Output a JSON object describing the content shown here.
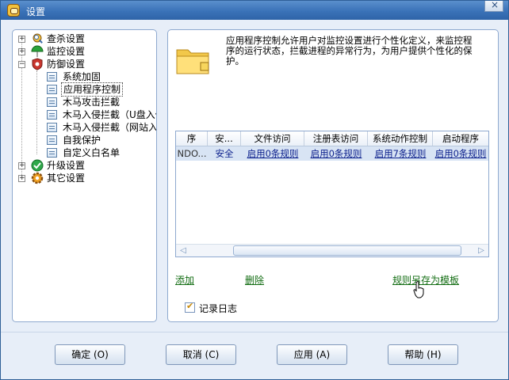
{
  "window": {
    "title": "设置",
    "close_glyph": "×"
  },
  "tree": {
    "items": [
      {
        "label": "查杀设置",
        "icon": "search-shield-icon",
        "expander": "+"
      },
      {
        "label": "监控设置",
        "icon": "umbrella-icon",
        "expander": "+"
      },
      {
        "label": "防御设置",
        "icon": "shield-icon",
        "expander": "−"
      },
      {
        "label": "系统加固",
        "icon": "page-icon"
      },
      {
        "label": "应用程序控制",
        "icon": "page-icon",
        "selected": true
      },
      {
        "label": "木马攻击拦截",
        "icon": "page-icon"
      },
      {
        "label": "木马入侵拦截（U盘入侵",
        "icon": "page-icon"
      },
      {
        "label": "木马入侵拦截（网站入侵",
        "icon": "page-icon"
      },
      {
        "label": "自我保护",
        "icon": "page-icon"
      },
      {
        "label": "自定义白名单",
        "icon": "page-icon"
      },
      {
        "label": "升级设置",
        "icon": "green-check-icon",
        "expander": "+"
      },
      {
        "label": "其它设置",
        "icon": "gear-icon",
        "expander": "+"
      }
    ]
  },
  "main": {
    "description": "应用程序控制允许用户对监控设置进行个性化定义，来监控程序的运行状态，拦截进程的异常行为，为用户提供个性化的保护。",
    "table": {
      "columns": [
        "序",
        "安...",
        "文件访问",
        "注册表访问",
        "系统动作控制",
        "启动程序"
      ],
      "row": [
        "NDO...",
        "安全",
        "启用0条规则",
        "启用0条规则",
        "启用7条规则",
        "启用0条规则"
      ]
    },
    "actions": {
      "add": "添加",
      "delete": "删除",
      "save_template": "规则另存为模板"
    },
    "log": {
      "label": "记录日志",
      "checked": true
    }
  },
  "buttons": {
    "ok": "确定 (O)",
    "cancel": "取消 (C)",
    "apply": "应用 (A)",
    "help": "帮助 (H)"
  },
  "colors": {
    "titlebar": "#3a72b8",
    "link_green": "#136d13",
    "row_text": "#0b1f8c",
    "selection": "#d8e4f4"
  }
}
